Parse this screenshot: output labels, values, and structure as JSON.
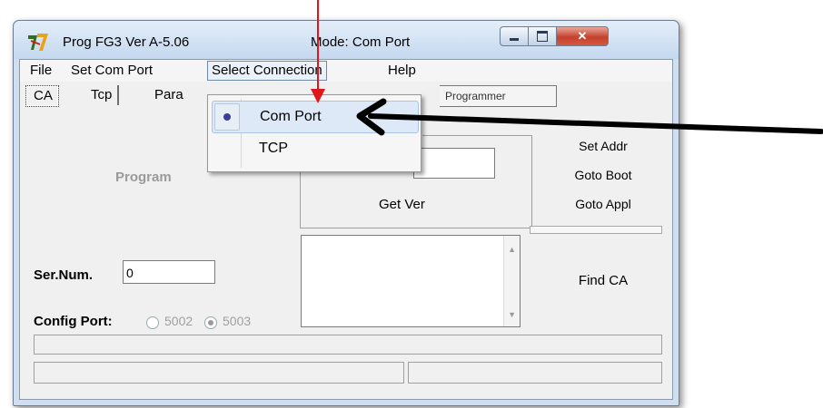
{
  "window": {
    "title": "Prog FG3  Ver A-5.06",
    "mode": "Mode: Com Port"
  },
  "menu": {
    "file": "File",
    "set_com_port": "Set Com Port",
    "select_connection": "Select Connection",
    "help": "Help"
  },
  "tabs": {
    "ca": "CA",
    "tcp": "Tcp",
    "params": "Para",
    "programmer": "Programmer"
  },
  "left_panel": {
    "program": "Program",
    "sernum_label": "Ser.Num.",
    "sernum_value": "0",
    "config_port_label": "Config Port:",
    "port_5002": "5002",
    "port_5003": "5003",
    "selected_port": "5003"
  },
  "middle_panel": {
    "get_ver": "Get Ver"
  },
  "right_panel": {
    "set_addr": "Set Addr",
    "goto_boot": "Goto Boot",
    "goto_appl": "Goto Appl",
    "find_ca": "Find CA"
  },
  "dropdown": {
    "items": [
      {
        "label": "Com Port",
        "checked": true
      },
      {
        "label": "TCP",
        "checked": false
      }
    ]
  },
  "colors": {
    "annotation_red": "#e0161b",
    "annotation_black": "#000000",
    "radio_selected_dot": "#3a3f9a"
  }
}
